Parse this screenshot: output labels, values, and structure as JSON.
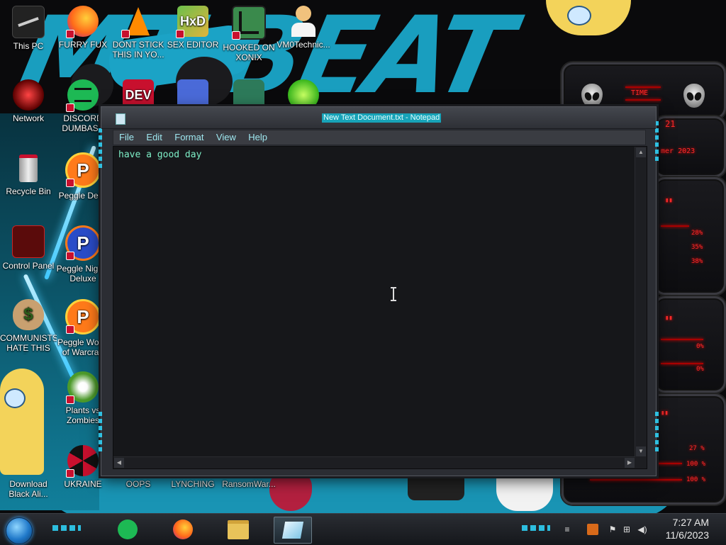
{
  "desktop": {
    "icons": [
      {
        "label": "This PC",
        "icon": "computer-icon"
      },
      {
        "label": "FURRY FUX",
        "icon": "firefox-icon"
      },
      {
        "label": "DONT STICK THIS IN YO...",
        "icon": "vlc-cone-icon"
      },
      {
        "label": "SEX EDITOR",
        "icon": "hxd-editor-icon"
      },
      {
        "label": "HOOKED ON XONIX",
        "icon": "xonix-game-icon"
      },
      {
        "label": "VM0Technic...",
        "icon": "doctor-avatar-icon"
      },
      {
        "label": "Network",
        "icon": "network-icon"
      },
      {
        "label": "DISCORD DUMBASS",
        "icon": "discord-green-icon"
      },
      {
        "label": "Recycle Bin",
        "icon": "recycle-bin-icon"
      },
      {
        "label": "Peggle Del...",
        "icon": "peggle-icon"
      },
      {
        "label": "Control Panel",
        "icon": "control-panel-icon"
      },
      {
        "label": "Peggle Nights Deluxe",
        "icon": "peggle-icon"
      },
      {
        "label": "COMMUNISTS HATE THIS G...",
        "icon": "money-bag-icon"
      },
      {
        "label": "Peggle World of Warcraft",
        "icon": "peggle-icon"
      },
      {
        "label": "Plants vs Zombies",
        "icon": "plants-vs-zombies-icon"
      },
      {
        "label": "Download Black Ali...",
        "icon": "character-icon"
      },
      {
        "label": "UKRAINE",
        "icon": "radiation-icon"
      },
      {
        "label": "OOPS",
        "icon": "blank-icon"
      },
      {
        "label": "LYNCHING",
        "icon": "blank-icon"
      },
      {
        "label": "RansomWar...",
        "icon": "blank-icon"
      },
      {
        "label": "DEV",
        "icon": "devcpp-icon"
      }
    ]
  },
  "gadget": {
    "header": "TIME",
    "lines": [
      "21",
      "mer 2023",
      "28%",
      "35%",
      "38%",
      "0%",
      "0%",
      "27 %",
      "100 %",
      "100 %"
    ]
  },
  "notepad": {
    "title": "New Text Document.txt - Notepad",
    "menu": [
      "File",
      "Edit",
      "Format",
      "View",
      "Help"
    ],
    "content": "have a good day"
  },
  "taskbar": {
    "clock_time": "7:27 AM",
    "clock_date": "11/6/2023",
    "colors": {
      "accent": "#2fd9ff",
      "wallpaper_blue": "#1aa6c9",
      "gadget_red": "#ff2a2a"
    }
  }
}
